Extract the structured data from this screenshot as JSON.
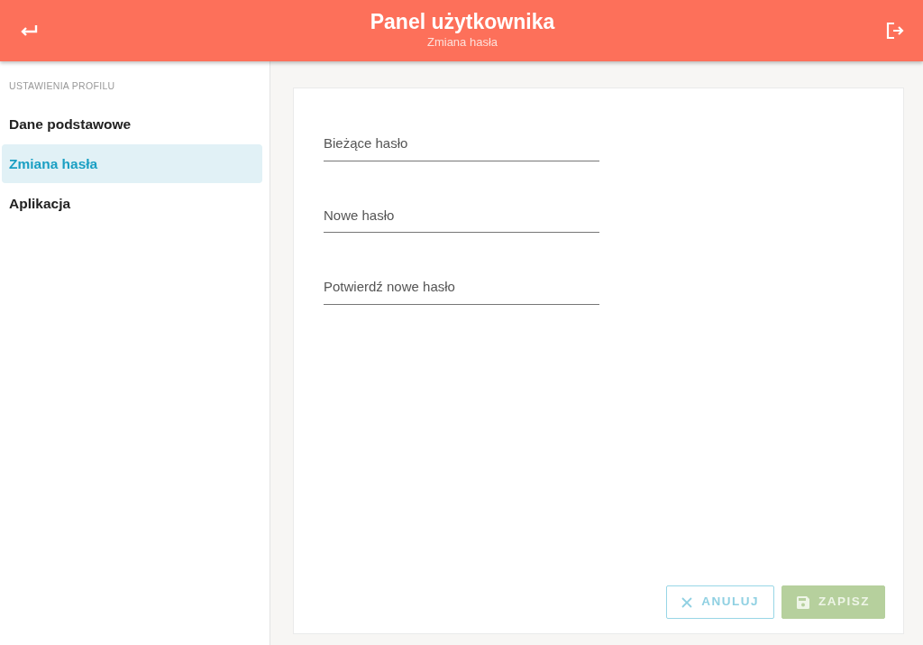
{
  "header": {
    "title": "Panel użytkownika",
    "subtitle": "Zmiana hasła"
  },
  "sidebar": {
    "heading": "USTAWIENIA PROFILU",
    "items": [
      {
        "label": "Dane podstawowe",
        "selected": false
      },
      {
        "label": "Zmiana hasła",
        "selected": true
      },
      {
        "label": "Aplikacja",
        "selected": false
      }
    ]
  },
  "form": {
    "fields": [
      {
        "placeholder": "Bieżące hasło"
      },
      {
        "placeholder": "Nowe hasło"
      },
      {
        "placeholder": "Potwierdź nowe hasło"
      }
    ]
  },
  "buttons": [
    {
      "kind": "cancel",
      "label": "ANULUJ",
      "disabled": true
    },
    {
      "kind": "save",
      "label": "ZAPISZ",
      "disabled": true
    }
  ]
}
